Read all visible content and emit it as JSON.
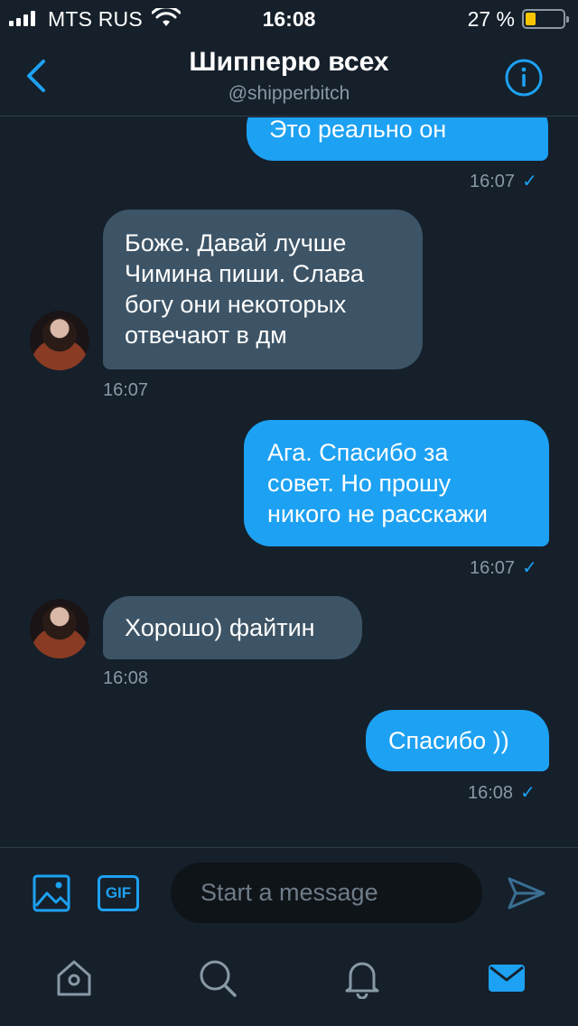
{
  "status_bar": {
    "carrier": "MTS RUS",
    "time": "16:08",
    "battery_percent": "27 %",
    "battery_level": 0.27
  },
  "header": {
    "title": "Шипперю всех",
    "handle": "@shipperbitch"
  },
  "messages": [
    {
      "direction": "sent",
      "text": "Это реально он",
      "time": "16:07",
      "read": true
    },
    {
      "direction": "received",
      "lines": [
        "Боже. Давай лучше",
        "Чимина пиши. Слава",
        "богу они некоторых",
        "отвечают в дм"
      ],
      "time": "16:07"
    },
    {
      "direction": "sent",
      "lines": [
        "Ага. Спасибо за",
        "совет. Но прошу",
        "никого не расскажи"
      ],
      "time": "16:07",
      "read": true
    },
    {
      "direction": "received",
      "text": "Хорошо) файтин",
      "time": "16:08"
    },
    {
      "direction": "sent",
      "text": "Спасибо ))",
      "time": "16:08",
      "read": true
    }
  ],
  "composer": {
    "placeholder": "Start a message",
    "gif_label": "GIF"
  },
  "tabbar": {
    "items": [
      "home-icon",
      "search-icon",
      "notifications-icon",
      "messages-icon"
    ],
    "active": "messages-icon"
  },
  "colors": {
    "background": "#15202b",
    "accent": "#1da1f2",
    "received_bubble": "#3d5466",
    "muted_text": "#8899a6"
  }
}
